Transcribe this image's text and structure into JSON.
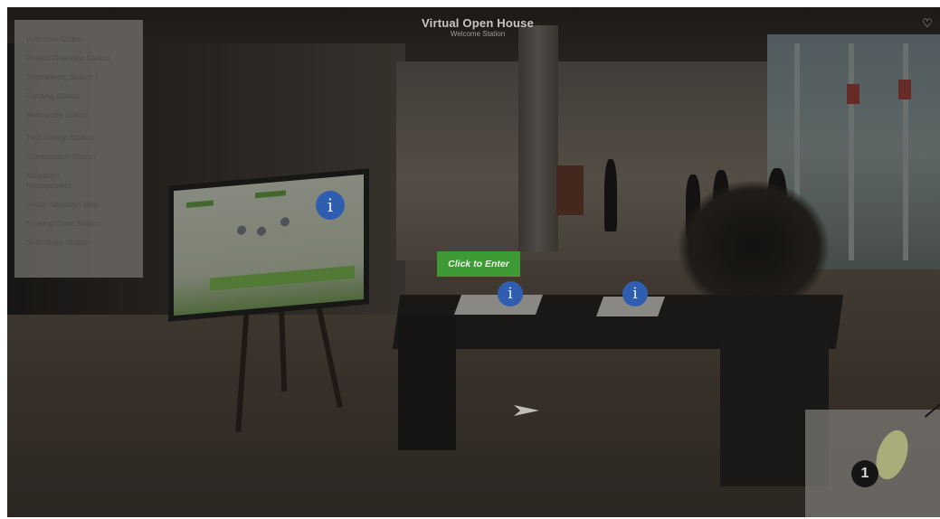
{
  "header": {
    "title": "Virtual Open House",
    "subtitle": "Welcome Station"
  },
  "sidebar": {
    "items": [
      {
        "label": "Welcome Station"
      },
      {
        "label": "Project Overview Station"
      },
      {
        "label": "Engineering Station I"
      },
      {
        "label": "Funding Station"
      },
      {
        "label": "Resources Station"
      },
      {
        "label": "Task Design Station"
      },
      {
        "label": "Construction Station"
      },
      {
        "label": "Mitigation"
      },
      {
        "label": "Management"
      },
      {
        "label": "Inside Attraction Map"
      },
      {
        "label": "Existing Cycle Station"
      },
      {
        "label": "Next Steps Station"
      }
    ]
  },
  "buttons": {
    "enter_label": "Click to Enter",
    "info_glyph": "i",
    "heart_glyph": "♡"
  },
  "minimap": {
    "marker_label": "1"
  },
  "icons": {
    "info": "info-icon",
    "heart": "heart-icon",
    "arrow": "navigation-arrow-icon",
    "minimap": "map-icon"
  },
  "colors": {
    "accent_green": "#3e9a35",
    "info_blue": "#2f5eb0",
    "panel_gray": "#787672"
  }
}
